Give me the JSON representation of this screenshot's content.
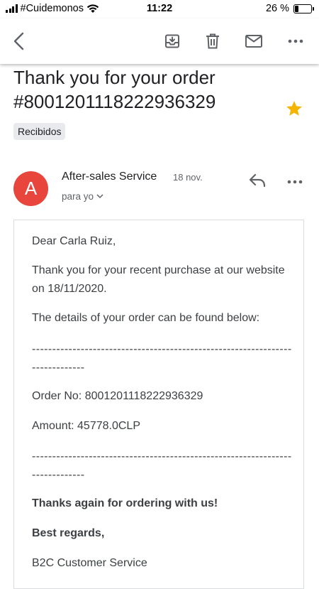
{
  "status_bar": {
    "carrier": "#Cuidemonos",
    "time": "11:22",
    "battery_percent": "26 %",
    "battery_level": 0.26
  },
  "toolbar": {
    "icons": [
      "back-arrow-icon",
      "archive-icon",
      "delete-icon",
      "mark-unread-icon",
      "more-vert-icon"
    ]
  },
  "email": {
    "subject": "Thank you for your order #8001201118222936329",
    "label": "Recibidos",
    "starred": true,
    "star_color": "#f4b400",
    "avatar_letter": "A",
    "avatar_color": "#e8453c",
    "sender": "After-sales Service",
    "date": "18 nov.",
    "recipient": "para yo",
    "body": {
      "greeting": "Dear Carla Ruiz,",
      "intro": "Thank you for your recent purchase at our website on 18/11/2020.",
      "details_intro": "The details of your order can be found below:",
      "separator_1": "-----------------------------------------------------------------------------",
      "order_no": "Order No: 8001201118222936329",
      "amount": "Amount: 45778.0CLP",
      "separator_2": "-----------------------------------------------------------------------------",
      "thanks": "Thanks again for ordering with us!",
      "regards": "Best regards,",
      "signature": "B2C Customer Service"
    }
  }
}
